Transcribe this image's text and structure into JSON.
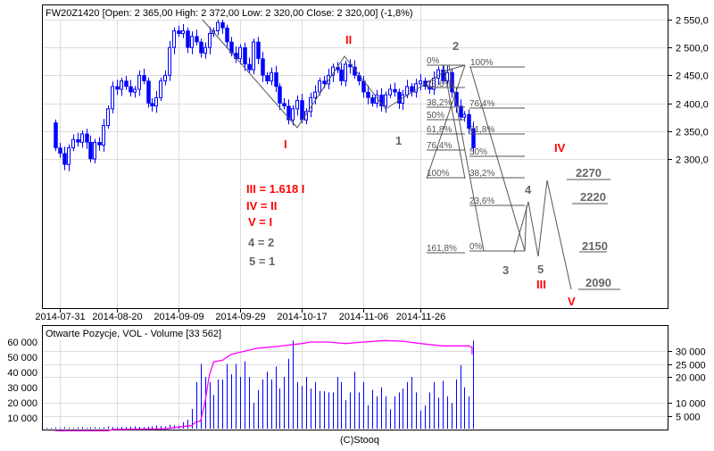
{
  "chart_data": [
    {
      "type": "candlestick",
      "title": "FW20Z1420 [Open: 2 365,00  High: 2 372,00  Low: 2 320,00  Close: 2 320,00] (-1,8%)",
      "first_open": 2365,
      "closes": [
        2320,
        2310,
        2290,
        2320,
        2335,
        2330,
        2345,
        2330,
        2300,
        2330,
        2325,
        2360,
        2390,
        2430,
        2425,
        2440,
        2430,
        2420,
        2425,
        2450,
        2440,
        2400,
        2395,
        2410,
        2440,
        2450,
        2500,
        2530,
        2525,
        2530,
        2500,
        2520,
        2510,
        2490,
        2500,
        2525,
        2530,
        2545,
        2535,
        2510,
        2490,
        2480,
        2500,
        2470,
        2460,
        2510,
        2480,
        2450,
        2440,
        2455,
        2430,
        2400,
        2395,
        2370,
        2390,
        2405,
        2370,
        2385,
        2410,
        2420,
        2440,
        2435,
        2450,
        2465,
        2460,
        2440,
        2470,
        2465,
        2450,
        2440,
        2420,
        2410,
        2400,
        2415,
        2395,
        2415,
        2425,
        2420,
        2400,
        2415,
        2430,
        2420,
        2435,
        2440,
        2430,
        2425,
        2445,
        2460,
        2440,
        2455,
        2420,
        2395,
        2375,
        2380,
        2355,
        2320
      ],
      "ylim": [
        2230,
        2580
      ],
      "y_ticks": [
        {
          "v": 2550,
          "label": "2 550,0"
        },
        {
          "v": 2500,
          "label": "2 500,0"
        },
        {
          "v": 2450,
          "label": "2 450,0"
        },
        {
          "v": 2400,
          "label": "2 400,0"
        },
        {
          "v": 2350,
          "label": "2 350,0"
        },
        {
          "v": 2300,
          "label": "2 300,0"
        }
      ],
      "x_ticks": [
        {
          "i": 1,
          "label": "2014-07-31"
        },
        {
          "i": 14,
          "label": "2014-08-20"
        },
        {
          "i": 28,
          "label": "2014-09-09"
        },
        {
          "i": 42,
          "label": "2014-09-29"
        },
        {
          "i": 56,
          "label": "2014-10-17"
        },
        {
          "i": 70,
          "label": "2014-11-06"
        },
        {
          "i": 83,
          "label": "2014-11-26"
        }
      ],
      "grid": true,
      "annotations": {
        "waves_red": [
          "I",
          "II",
          "III",
          "IV",
          "V"
        ],
        "waves_grey": [
          "1",
          "2",
          "3",
          "4",
          "5"
        ],
        "fib_left": [
          "0%",
          "23,6%",
          "38,2%",
          "50%",
          "61,8%",
          "76,4%",
          "100%",
          "161,8%"
        ],
        "fib_right": [
          "100%",
          "76,4%",
          "61,8%",
          "50%",
          "38,2%",
          "23,6%",
          "0%"
        ],
        "targets": [
          "2270",
          "2220",
          "2150",
          "2090"
        ],
        "rules_red": [
          "III = 1.618 I",
          "IV = II",
          "V = I"
        ],
        "rules_grey": [
          "4 = 2",
          "5 = 1"
        ]
      }
    },
    {
      "type": "bar+line",
      "title": "Otwarte Pozycje, VOL - Volume [33 562]",
      "volume": [
        400,
        300,
        500,
        300,
        600,
        400,
        300,
        500,
        700,
        400,
        500,
        600,
        400,
        500,
        800,
        600,
        500,
        700,
        600,
        800,
        900,
        700,
        600,
        800,
        900,
        1200,
        1000,
        900,
        1500,
        1300,
        1100,
        2500,
        3500,
        7600,
        18000,
        25000,
        20000,
        18000,
        13000,
        19000,
        19000,
        25000,
        21000,
        25000,
        20000,
        26000,
        20000,
        10000,
        15000,
        19000,
        22000,
        19000,
        24000,
        15500,
        20000,
        27000,
        34000,
        18000,
        16500,
        20000,
        15500,
        18000,
        14500,
        14500,
        14000,
        14000,
        20000,
        18000,
        11000,
        14000,
        22000,
        14000,
        18000,
        9000,
        15000,
        12500,
        16000,
        12500,
        7500,
        12500,
        14000,
        15500,
        18000,
        20000,
        14000,
        7000,
        9000,
        14000,
        18000,
        12000,
        18500,
        12500,
        10000,
        19000,
        24500,
        16000,
        12500,
        34000
      ],
      "open_interest": [
        [
          0,
          1500
        ],
        [
          12,
          1500
        ],
        [
          13,
          2500
        ],
        [
          25,
          2800
        ],
        [
          28,
          4000
        ],
        [
          31,
          5000
        ],
        [
          32,
          7500
        ],
        [
          33,
          8000
        ],
        [
          34,
          20000
        ],
        [
          35,
          38000
        ],
        [
          36,
          47000
        ],
        [
          38,
          48000
        ],
        [
          40,
          52000
        ],
        [
          43,
          54000
        ],
        [
          46,
          56000
        ],
        [
          50,
          57000
        ],
        [
          56,
          59000
        ],
        [
          58,
          60000
        ],
        [
          62,
          60000
        ],
        [
          66,
          59000
        ],
        [
          70,
          60000
        ],
        [
          75,
          61000
        ],
        [
          79,
          60500
        ],
        [
          83,
          59000
        ],
        [
          88,
          57500
        ],
        [
          94,
          57500
        ],
        [
          96,
          56500
        ],
        [
          97,
          52000
        ]
      ],
      "left_ticks": [
        {
          "v": 60000,
          "label": "60 000"
        },
        {
          "v": 50000,
          "label": "50 000"
        },
        {
          "v": 40000,
          "label": "40 000"
        },
        {
          "v": 30000,
          "label": "30 000"
        },
        {
          "v": 20000,
          "label": "20 000"
        },
        {
          "v": 10000,
          "label": "10 000"
        }
      ],
      "right_ticks": [
        {
          "v": 30000,
          "label": "30 000"
        },
        {
          "v": 25000,
          "label": "25 000"
        },
        {
          "v": 20000,
          "label": "20 000"
        },
        {
          "v": 10000,
          "label": "10 000"
        },
        {
          "v": 5000,
          "label": "5 000"
        }
      ],
      "colors": {
        "volume": "#0000ff",
        "open_interest": "#ff00ff",
        "up_candle": "#ffffff",
        "down_candle": "#0000ff"
      }
    }
  ],
  "footer": "(C)Stooq"
}
